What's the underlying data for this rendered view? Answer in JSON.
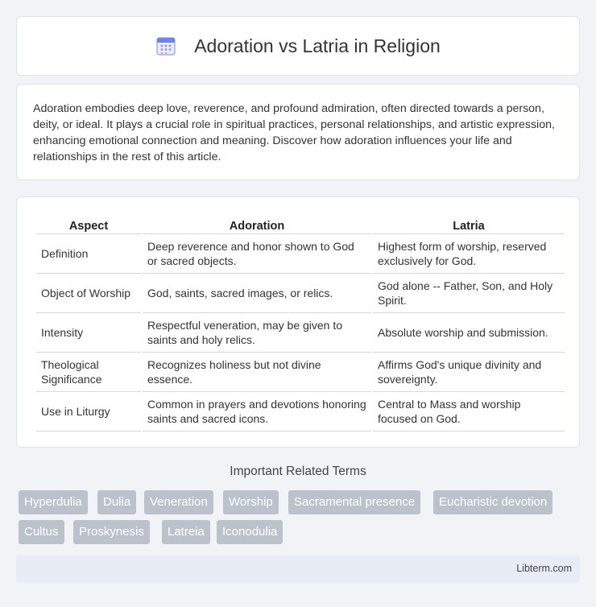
{
  "header": {
    "title": "Adoration vs Latria in Religion",
    "icon": "calendar-icon"
  },
  "intro": {
    "text": "Adoration embodies deep love, reverence, and profound admiration, often directed towards a person, deity, or ideal. It plays a crucial role in spiritual practices, personal relationships, and artistic expression, enhancing emotional connection and meaning. Discover how adoration influences your life and relationships in the rest of this article."
  },
  "table": {
    "headers": [
      "Aspect",
      "Adoration",
      "Latria"
    ],
    "rows": [
      [
        "Definition",
        "Deep reverence and honor shown to God or sacred objects.",
        "Highest form of worship, reserved exclusively for God."
      ],
      [
        "Object of Worship",
        "God, saints, sacred images, or relics.",
        "God alone -- Father, Son, and Holy Spirit."
      ],
      [
        "Intensity",
        "Respectful veneration, may be given to saints and holy relics.",
        "Absolute worship and submission."
      ],
      [
        "Theological Significance",
        "Recognizes holiness but not divine essence.",
        "Affirms God's unique divinity and sovereignty."
      ],
      [
        "Use in Liturgy",
        "Common in prayers and devotions honoring saints and sacred icons.",
        "Central to Mass and worship focused on God."
      ]
    ]
  },
  "related": {
    "title": "Important Related Terms",
    "tags": [
      "Hyperdulia",
      "Dulia",
      "Veneration",
      "Worship",
      "Sacramental presence",
      "Eucharistic devotion",
      "Cultus",
      "Proskynesis",
      "Latreia",
      "Iconodulia"
    ]
  },
  "footer": {
    "text": "Libterm.com"
  },
  "colors": {
    "background": "#f2f3f7",
    "tag": "#bcc2cc",
    "footer": "#e8ecf5",
    "icon_accent": "#7a8cf0"
  }
}
